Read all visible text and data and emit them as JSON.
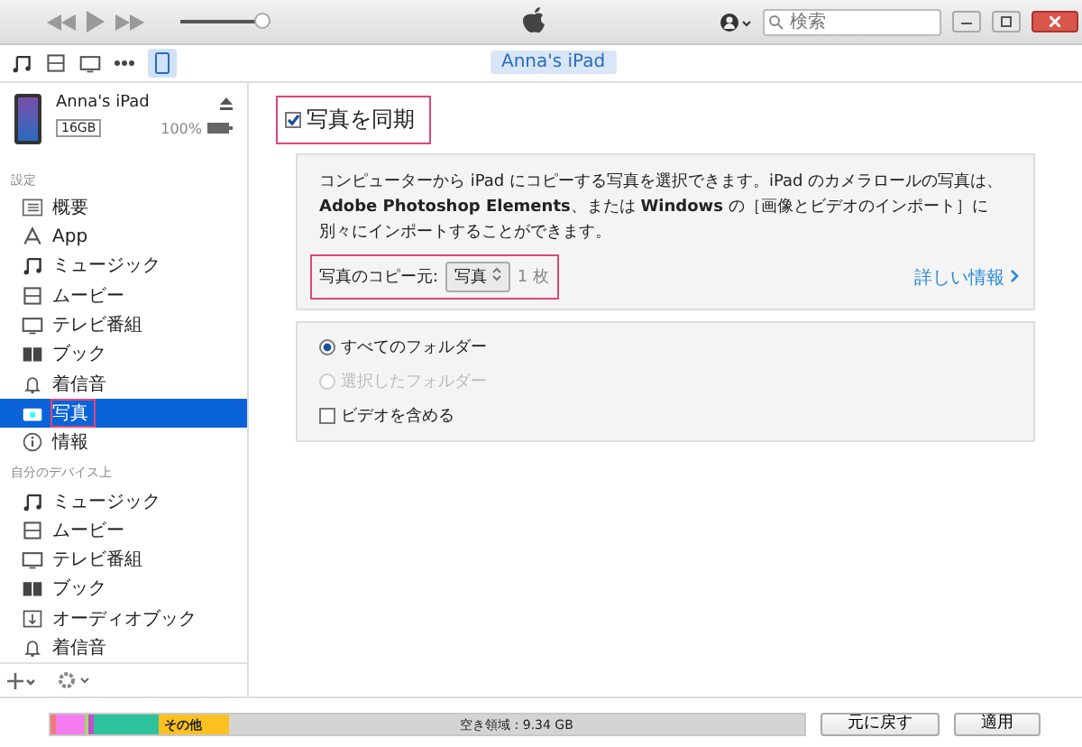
{
  "toolbar": {
    "search": {
      "placeholder": "検索"
    },
    "device_tab": {
      "label": "Anna's iPad"
    },
    "volume": {
      "level": 0.9
    }
  },
  "device": {
    "name": "Anna's iPad",
    "capacity": "16GB",
    "battery": "100%"
  },
  "sidebar": {
    "sections": [
      {
        "title": "設定",
        "items": [
          {
            "label": "概要",
            "kind": "summary",
            "selected": false,
            "highlighted": false
          },
          {
            "label": "App",
            "kind": "app",
            "selected": false,
            "highlighted": false
          },
          {
            "label": "ミュージック",
            "kind": "music",
            "selected": false,
            "highlighted": false
          },
          {
            "label": "ムービー",
            "kind": "movie",
            "selected": false,
            "highlighted": false
          },
          {
            "label": "テレビ番組",
            "kind": "tv",
            "selected": false,
            "highlighted": false
          },
          {
            "label": "ブック",
            "kind": "book",
            "selected": false,
            "highlighted": false
          },
          {
            "label": "着信音",
            "kind": "tone",
            "selected": false,
            "highlighted": false
          },
          {
            "label": "写真",
            "kind": "photo",
            "selected": true,
            "highlighted": true
          },
          {
            "label": "情報",
            "kind": "info",
            "selected": false,
            "highlighted": false
          }
        ]
      },
      {
        "title": "自分のデバイス上",
        "items": [
          {
            "label": "ミュージック",
            "kind": "music",
            "selected": false,
            "highlighted": false
          },
          {
            "label": "ムービー",
            "kind": "movie",
            "selected": false,
            "highlighted": false
          },
          {
            "label": "テレビ番組",
            "kind": "tv",
            "selected": false,
            "highlighted": false
          },
          {
            "label": "ブック",
            "kind": "book",
            "selected": false,
            "highlighted": false
          },
          {
            "label": "オーディオブック",
            "kind": "audiobook",
            "selected": false,
            "highlighted": false
          },
          {
            "label": "着信音",
            "kind": "tone",
            "selected": false,
            "highlighted": false
          }
        ]
      }
    ]
  },
  "sync": {
    "label": "写真を同期",
    "checked": true,
    "highlighted": true
  },
  "info_panel": {
    "description": "コンピューターから iPad にコピーする写真を選択できます。iPad のカメラロールの写真は、**Adobe Photoshop Elements**、または **Windows** の［画像とビデオのインポート］に別々にインポートすることができます。",
    "copy_from": {
      "label": "写真のコピー元:",
      "value": "写真",
      "count": "1 枚",
      "highlighted": true
    },
    "more_info": "詳しい情報"
  },
  "options": [
    {
      "kind": "radio",
      "label": "すべてのフォルダー",
      "checked": true,
      "disabled": false
    },
    {
      "kind": "radio",
      "label": "選択したフォルダー",
      "checked": false,
      "disabled": true
    },
    {
      "kind": "checkbox",
      "label": "ビデオを含める",
      "checked": false,
      "disabled": false
    }
  ],
  "storage": {
    "segments": [
      {
        "color": "#f07a7a"
      },
      {
        "color": "#f47cf0"
      },
      {
        "color": "#a6d86a"
      },
      {
        "color": "#c050c8"
      },
      {
        "color": "#2cc29c"
      },
      {
        "color": "#fcc020",
        "label": "その他"
      }
    ],
    "free": "空き領域 : 9.34 GB"
  },
  "buttons": [
    {
      "label": "元に戻す"
    },
    {
      "label": "適用"
    }
  ]
}
